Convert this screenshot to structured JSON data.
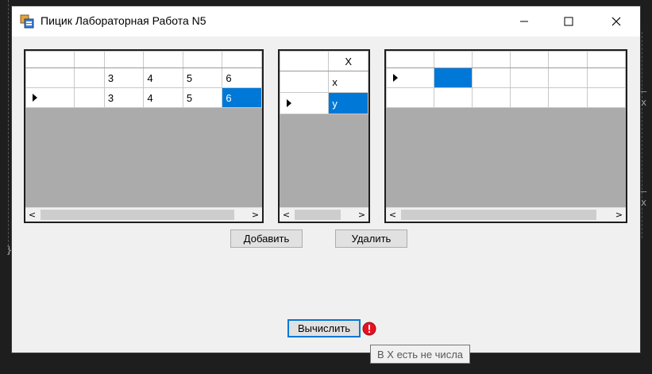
{
  "window": {
    "title": "Пицик Лабораторная Работа N5"
  },
  "grid1": {
    "header": [
      "",
      "",
      "",
      "",
      "",
      ""
    ],
    "rows": [
      [
        "",
        "",
        "3",
        "4",
        "5",
        "6"
      ],
      [
        "",
        "",
        "3",
        "4",
        "5",
        "6"
      ]
    ],
    "selected_value": "6"
  },
  "grid2": {
    "header": [
      "",
      "X"
    ],
    "rows": [
      [
        "",
        "x"
      ],
      [
        "",
        "y"
      ]
    ]
  },
  "grid3": {
    "header": [
      "",
      "",
      "",
      "",
      "",
      ""
    ],
    "rows": [
      [
        "",
        "",
        "",
        "",
        "",
        ""
      ],
      [
        "",
        "",
        "",
        "",
        "",
        ""
      ]
    ]
  },
  "buttons": {
    "add": "Добавить",
    "delete": "Удалить",
    "compute": "Вычислить"
  },
  "error": {
    "tooltip": "В X есть не числа"
  },
  "scroll": {
    "left_glyph": "<",
    "right_glyph": ">"
  },
  "background": {
    "glyph_brace": "}",
    "glyph_arrow1": "– x",
    "glyph_arrow2": "– x"
  },
  "colors": {
    "selection": "#0078d7",
    "grid_background": "#ababab",
    "error": "#e81123"
  }
}
